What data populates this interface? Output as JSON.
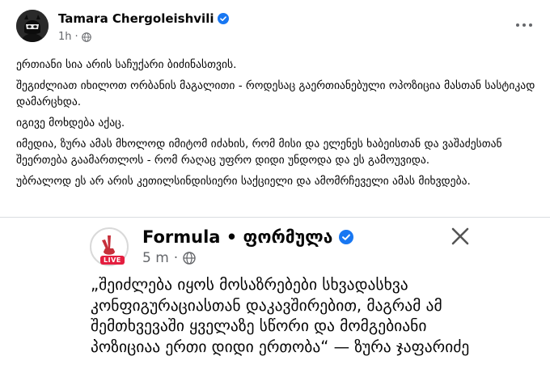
{
  "post": {
    "author": "Tamara Chergoleishvili",
    "time": "1h",
    "dot": "·",
    "paragraphs": [
      "ერთიანი სია არის საჩუქარი ბიძინასთვის.",
      "შეგიძლიათ იხილოთ ორბანის მაგალითი - როდესაც გაერთიანებული ოპოზიცია მასთან სასტიკად დამარცხდა.",
      "იგივე მოხდება აქაც.",
      "იმედია, ზურა ამას მხოლოდ იმიტომ იძახის, რომ მისი და ელენეს ხაბეისთან და ვაშაძესთან შეერთება გაამართლოს - რომ რაღაც უფრო დიდი უნდოდა და ეს გამოუვიდა.",
      "უბრალოდ ეს არ არის კეთილსინდისიერი საქციელი და ამომრჩეველი ამას მიხვდება."
    ]
  },
  "shared": {
    "page_name": "Formula • ფორმულა",
    "time": "5 m",
    "dot": "·",
    "live_badge": "LIVE",
    "quote": "„შეიძლება იყოს მოსაზრებები სხვადასხვა კონფიგურაციასთან დაკავშირებით, მაგრამ ამ შემთხვევაში ყველაზე სწორი და მომგებიანი პოზიციაა ერთი დიდი ერთობა“ — ზურა ჯაფარიძე"
  },
  "colors": {
    "verified": "#1877f2",
    "live": "#e41e3f",
    "secondary_text": "#65676b"
  },
  "icons": [
    "verified-badge-icon",
    "globe-icon",
    "more-options-icon",
    "close-icon"
  ]
}
